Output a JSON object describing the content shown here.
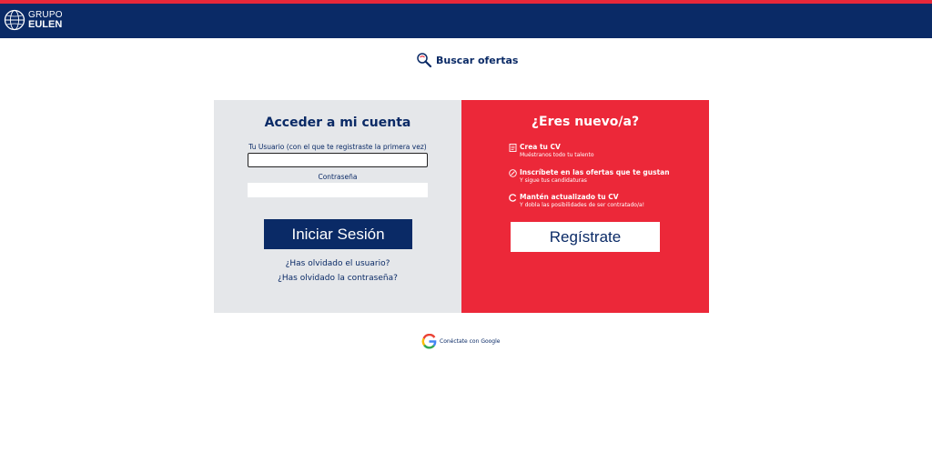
{
  "header": {
    "logo_line1": "GRUPO",
    "logo_line2": "EULEN"
  },
  "search": {
    "label": "Buscar ofertas"
  },
  "login": {
    "title": "Acceder a mi cuenta",
    "username_label": "Tu Usuario (con el que te registraste la primera vez)",
    "username_value": "",
    "password_label": "Contraseña",
    "password_value": "",
    "submit_label": "Iniciar Sesión",
    "forgot_user": "¿Has olvidado el usuario?",
    "forgot_password": "¿Has olvidado la contraseña?"
  },
  "register": {
    "title": "¿Eres nuevo/a?",
    "benefits": [
      {
        "icon": "document-icon",
        "title": "Crea tu CV",
        "subtitle": "Muéstranos todo tu talento"
      },
      {
        "icon": "check-circle-icon",
        "title": "Inscríbete en las ofertas que te gustan",
        "subtitle": "Y sigue tus candidaturas"
      },
      {
        "icon": "refresh-icon",
        "title": "Mantén actualizado tu CV",
        "subtitle": "Y dobla las posibilidades de ser contratado/a!"
      }
    ],
    "button_label": "Regístrate"
  },
  "google": {
    "label": "Conéctate con Google"
  },
  "colors": {
    "navy": "#0a2a66",
    "red": "#ec2839",
    "panel_gray": "#e5e7ea"
  }
}
